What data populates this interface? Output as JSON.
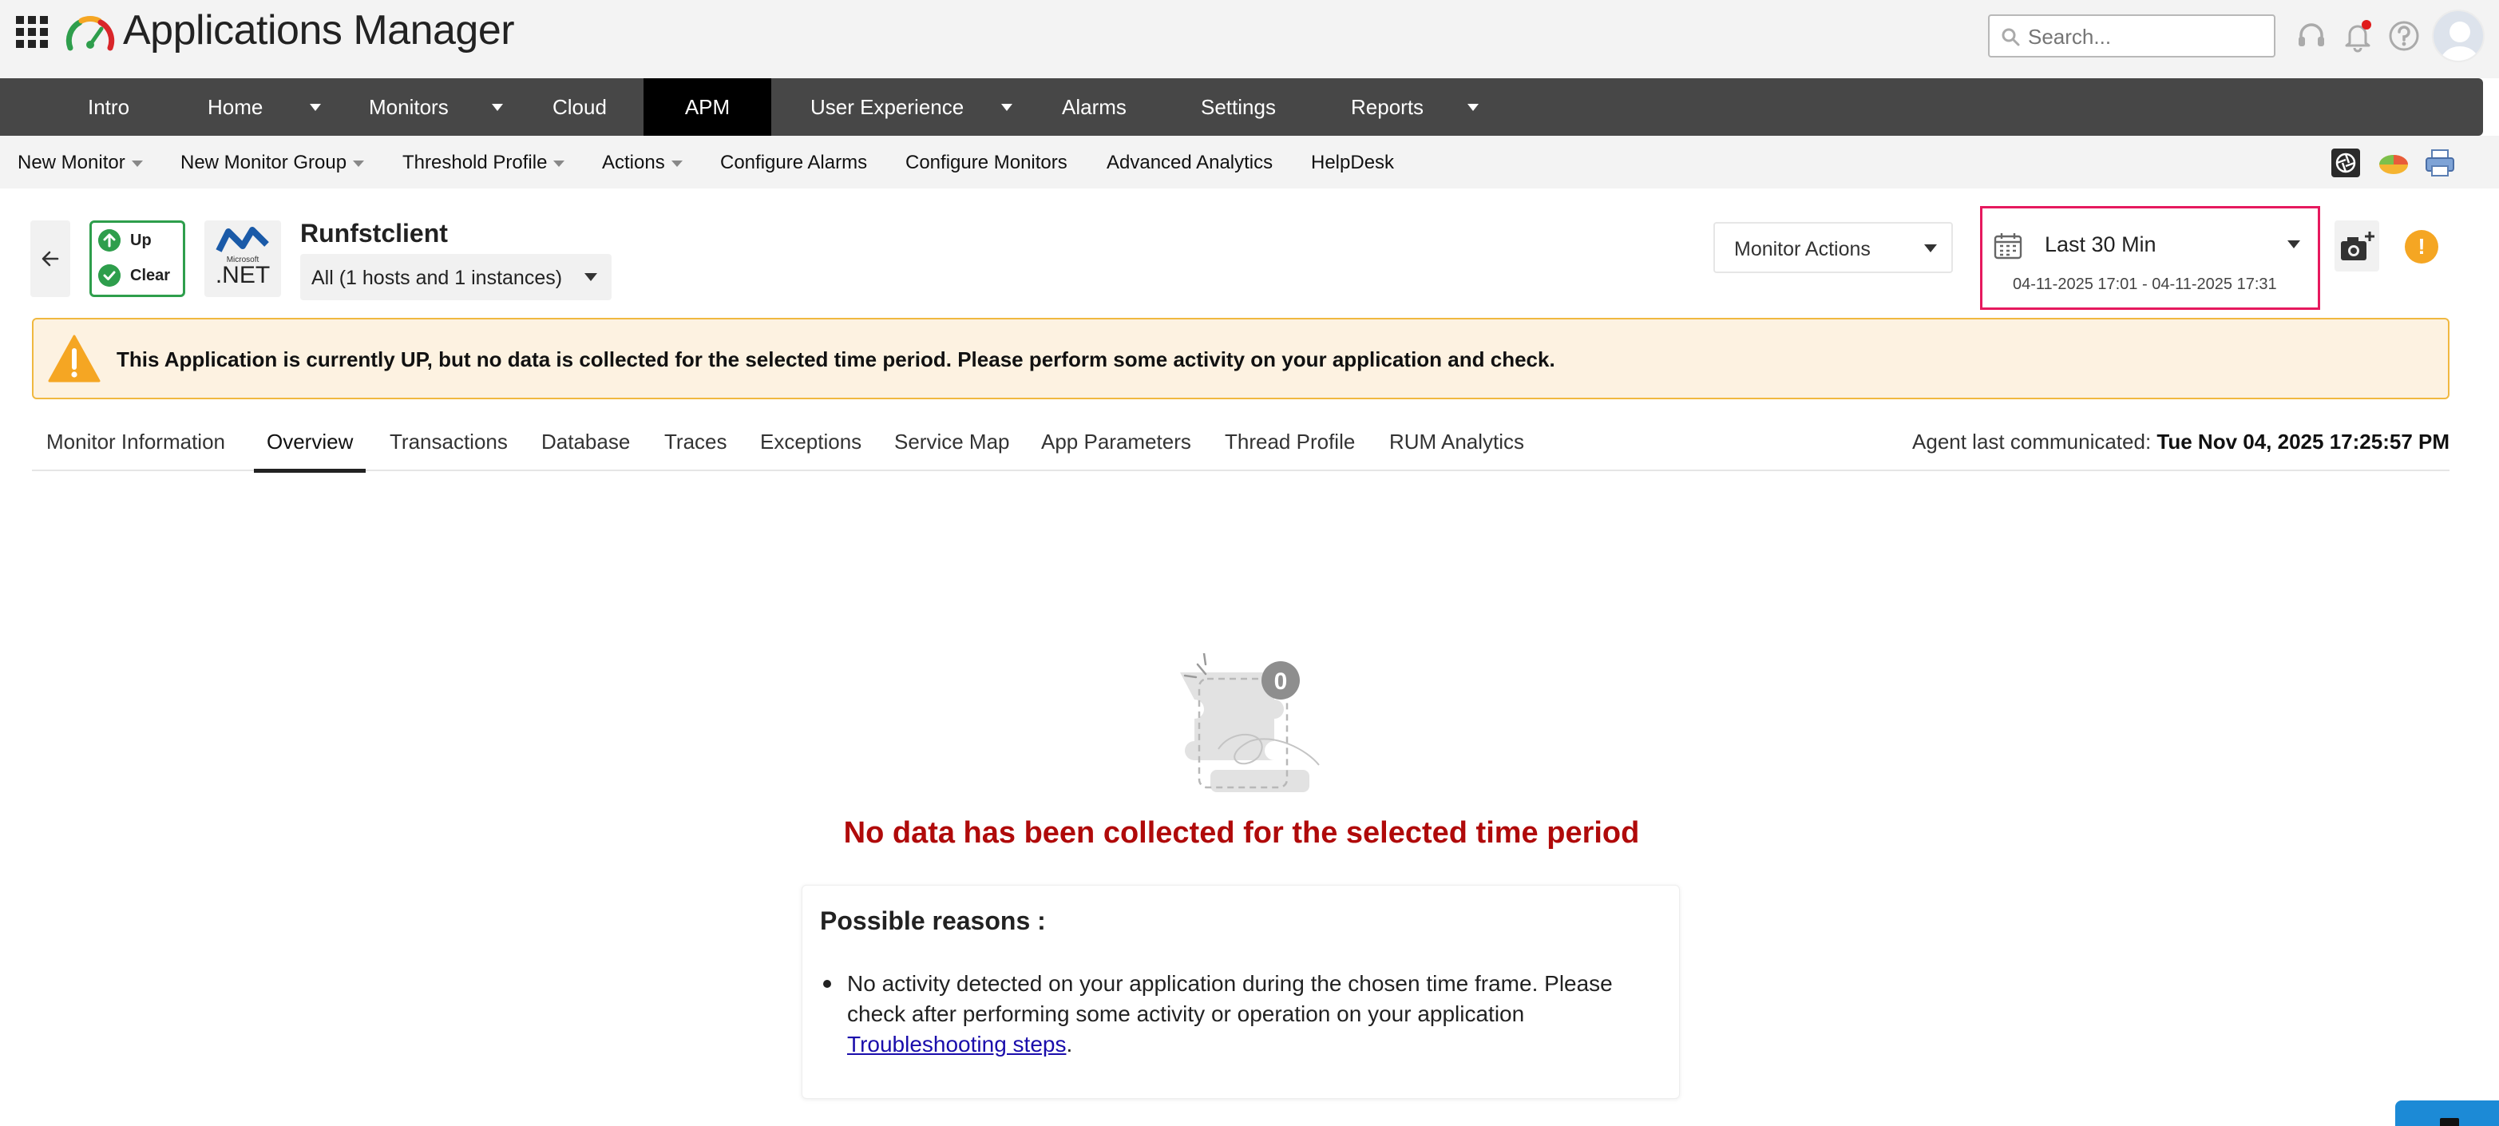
{
  "app": {
    "title": "Applications Manager"
  },
  "search": {
    "placeholder": "Search..."
  },
  "nav": {
    "items": [
      {
        "label": "Intro"
      },
      {
        "label": "Home"
      },
      {
        "label": "Monitors"
      },
      {
        "label": "Cloud"
      },
      {
        "label": "APM"
      },
      {
        "label": "User Experience"
      },
      {
        "label": "Alarms"
      },
      {
        "label": "Settings"
      },
      {
        "label": "Reports"
      }
    ],
    "active": "APM"
  },
  "subnav": {
    "items": [
      {
        "label": "New Monitor"
      },
      {
        "label": "New Monitor Group"
      },
      {
        "label": "Threshold Profile"
      },
      {
        "label": "Actions"
      },
      {
        "label": "Configure Alarms"
      },
      {
        "label": "Configure Monitors"
      },
      {
        "label": "Advanced Analytics"
      },
      {
        "label": "HelpDesk"
      }
    ]
  },
  "monitor": {
    "name": "Runfstclient",
    "status": {
      "availability": "Up",
      "health": "Clear"
    },
    "logo": {
      "brand": "Microsoft",
      "text": ".NET"
    },
    "instance_selector": "All (1 hosts and 1 instances)",
    "actions_label": "Monitor Actions",
    "time_period": "Last 30 Min",
    "time_range": "04-11-2025 17:01 - 04-11-2025 17:31",
    "alert_symbol": "!"
  },
  "banner": {
    "message": "This Application is currently UP, but no data is collected for the selected time period. Please perform some activity on your application and check."
  },
  "tabs": {
    "items": [
      {
        "label": "Monitor Information"
      },
      {
        "label": "Overview"
      },
      {
        "label": "Transactions"
      },
      {
        "label": "Database"
      },
      {
        "label": "Traces"
      },
      {
        "label": "Exceptions"
      },
      {
        "label": "Service Map"
      },
      {
        "label": "App Parameters"
      },
      {
        "label": "Thread Profile"
      },
      {
        "label": "RUM Analytics"
      }
    ],
    "active": "Overview"
  },
  "agent": {
    "label": "Agent last communicated:",
    "value": "Tue Nov 04, 2025 17:25:57 PM"
  },
  "empty_state": {
    "badge_count": "0",
    "message": "No data has been collected for the selected time period",
    "reasons_title": "Possible reasons :",
    "reason_text": "No activity detected on your application during the chosen time frame. Please check after performing some activity or operation on your application",
    "reason_link": "Troubleshooting steps",
    "reason_end": "."
  },
  "colors": {
    "nav_bg": "#474747",
    "nav_active": "#000000",
    "status_green": "#2e9e4c",
    "highlight_border": "#e6195e",
    "warning_bg": "#fdf2e1",
    "warning_border": "#f0b840",
    "nodata_red": "#b00a0a",
    "alert_orange": "#f5a623",
    "link_blue": "#1a0dab"
  }
}
